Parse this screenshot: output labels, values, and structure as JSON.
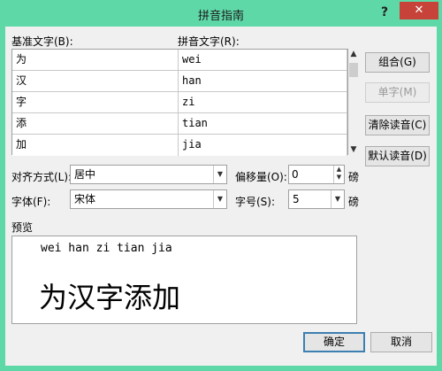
{
  "window": {
    "title": "拼音指南",
    "help_label": "?",
    "close_label": "✕"
  },
  "labels": {
    "base_text": "基准文字(B):",
    "pinyin_text": "拼音文字(R):",
    "alignment": "对齐方式(L):",
    "offset": "偏移量(O):",
    "font": "字体(F):",
    "size": "字号(S):",
    "preview": "预览",
    "unit_pt_1": "磅",
    "unit_pt_2": "磅"
  },
  "rows": [
    {
      "base": "为",
      "pinyin": "wei"
    },
    {
      "base": "汉",
      "pinyin": "han"
    },
    {
      "base": "字",
      "pinyin": "zi"
    },
    {
      "base": "添",
      "pinyin": "tian"
    },
    {
      "base": "加",
      "pinyin": "jia"
    }
  ],
  "buttons": {
    "combine": "组合(G)",
    "single": "单字(M)",
    "clear": "清除读音(C)",
    "default_reading": "默认读音(D)",
    "ok": "确定",
    "cancel": "取消"
  },
  "fields": {
    "alignment_value": "居中",
    "offset_value": "0",
    "font_value": "宋体",
    "size_value": "5"
  },
  "preview": {
    "pinyin_line": "wei han  zi  tian jia",
    "hanzi_line": "为汉字添加"
  },
  "colors": {
    "title_bar": "#5fd8a8",
    "close": "#c7433a",
    "dialog_bg": "#f0f0f0"
  }
}
